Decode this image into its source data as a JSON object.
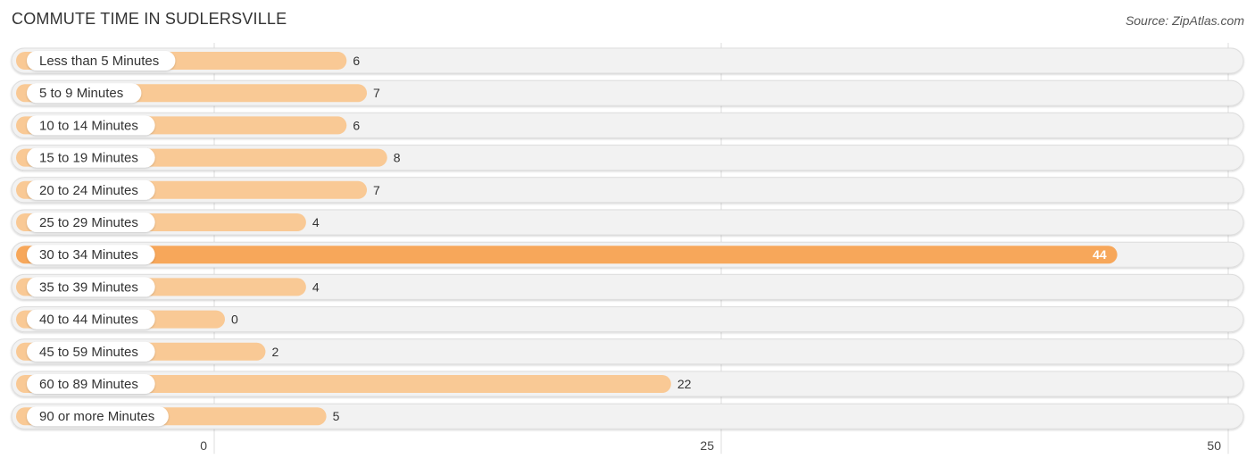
{
  "header": {
    "title": "COMMUTE TIME IN SUDLERSVILLE",
    "source": "Source: ZipAtlas.com"
  },
  "colors": {
    "bar": "#f9c995",
    "bar_highlight": "#f7a75a",
    "track": "#f2f2f2",
    "track_border": "#dddddd",
    "grid": "#dddddd"
  },
  "chart_data": {
    "type": "bar",
    "orientation": "horizontal",
    "title": "COMMUTE TIME IN SUDLERSVILLE",
    "xlabel": "",
    "ylabel": "",
    "categories": [
      "Less than 5 Minutes",
      "5 to 9 Minutes",
      "10 to 14 Minutes",
      "15 to 19 Minutes",
      "20 to 24 Minutes",
      "25 to 29 Minutes",
      "30 to 34 Minutes",
      "35 to 39 Minutes",
      "40 to 44 Minutes",
      "45 to 59 Minutes",
      "60 to 89 Minutes",
      "90 or more Minutes"
    ],
    "values": [
      6,
      7,
      6,
      8,
      7,
      4,
      44,
      4,
      0,
      2,
      22,
      5
    ],
    "highlight_index": 6,
    "xlim": [
      0,
      50
    ],
    "xticks": [
      0,
      25,
      50
    ],
    "grid": true
  }
}
